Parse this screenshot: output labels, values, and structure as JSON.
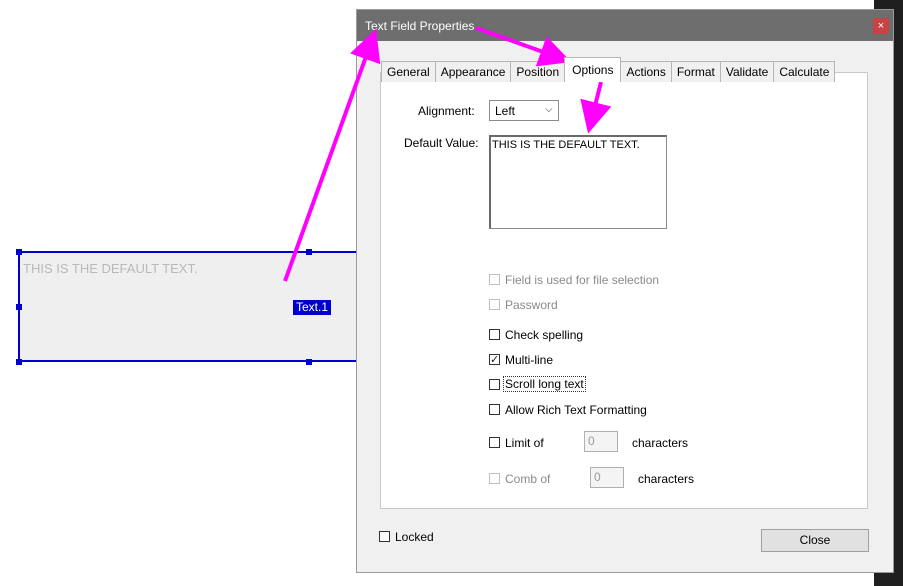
{
  "form_field": {
    "default_text": "THIS IS THE DEFAULT TEXT.",
    "name": "Text.1"
  },
  "dialog": {
    "title": "Text Field Properties",
    "close_glyph": "×",
    "tabs": [
      "General",
      "Appearance",
      "Position",
      "Options",
      "Actions",
      "Format",
      "Validate",
      "Calculate"
    ],
    "active_tab": "Options",
    "options": {
      "alignment_label": "Alignment:",
      "alignment_value": "Left",
      "default_value_label": "Default Value:",
      "default_value": "THIS IS THE DEFAULT TEXT.",
      "file_selection_label": "Field is used for file selection",
      "password_label": "Password",
      "check_spelling_label": "Check spelling",
      "multiline_label": "Multi-line",
      "multiline_checked": true,
      "scroll_long_text_label": "Scroll long text",
      "rich_text_label": "Allow Rich Text Formatting",
      "limit_of_label": "Limit of",
      "limit_of_value": "0",
      "limit_characters_label": "characters",
      "comb_of_label": "Comb of",
      "comb_of_value": "0",
      "comb_characters_label": "characters"
    },
    "locked_label": "Locked",
    "close_button_label": "Close"
  },
  "colors": {
    "field_border": "#0000cc",
    "annotation_arrow": "#ff00ff",
    "titlebar": "#6e6e6e"
  }
}
